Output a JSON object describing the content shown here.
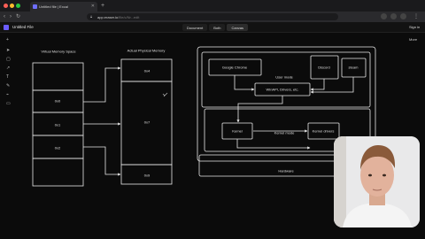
{
  "browser": {
    "tab_title": "Untitled file | Excal",
    "url_host": "app.eraser.io",
    "url_path": "/file/c/Nr...edit",
    "traffic_colors": [
      "#ff5f57",
      "#febc2e",
      "#28c840"
    ]
  },
  "app": {
    "file_title": "Untitled File",
    "modes": [
      "Document",
      "Both",
      "Canvas"
    ],
    "active_mode": "Canvas",
    "sign_in": "Sign in",
    "more": "More"
  },
  "diagram": {
    "virtual_title": "Virtual Memory Space",
    "physical_title": "Actual Physical Memory",
    "virtual_labels": [
      "0x0",
      "0x1",
      "0x2"
    ],
    "physical_labels": [
      "0x4",
      "0x7",
      "0x9"
    ],
    "user_mode": "User mode",
    "kernel_mode": "Kernel mode",
    "hardware": "Hardware",
    "chrome": "Google Chrome",
    "discord": "Discord",
    "steam": "steam",
    "winapi": "WinAPI, Drivers, etc.",
    "kernel": "Kernel",
    "kernel_drivers": "Kernel drivers"
  },
  "accent": "#6b5cff"
}
